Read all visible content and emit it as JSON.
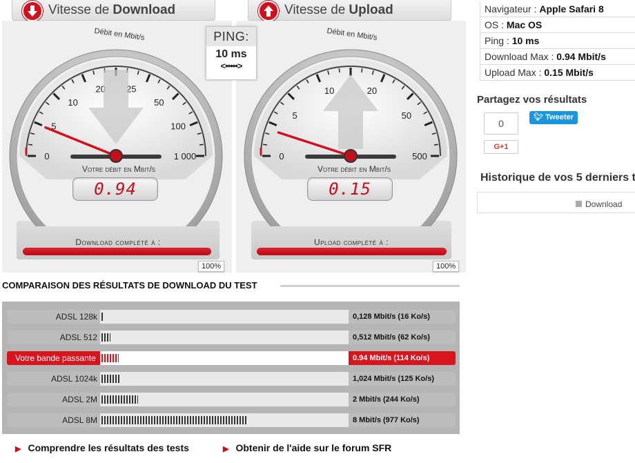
{
  "download": {
    "header_prefix": "Vitesse de",
    "header_bold": "Download",
    "unit_arc": "Débit en Mbit/s",
    "scale": [
      "0",
      "5",
      "10",
      "20",
      "25",
      "50",
      "100",
      "1 000"
    ],
    "caption": "Votre débit en Mbit/s",
    "value": "0.94",
    "complete_label": "Download complété à :",
    "progress": 1.0,
    "percent": "100%"
  },
  "upload": {
    "header_prefix": "Vitesse de",
    "header_bold": "Upload",
    "unit_arc": "Débit en Mbit/s",
    "scale": [
      "0",
      "5",
      "10",
      "20",
      "50",
      "500"
    ],
    "caption": "Votre débit en Mbit/s",
    "value": "0.15",
    "complete_label": "Upload complété à :",
    "progress": 1.0,
    "percent": "100%"
  },
  "ping": {
    "title": "PING:",
    "value": "10 ms",
    "dots": "<•••••>"
  },
  "info": [
    {
      "label": "Navigateur :",
      "value": "Apple Safari 8"
    },
    {
      "label": "OS :",
      "value": "Mac OS"
    },
    {
      "label": "Ping :",
      "value": "10 ms"
    },
    {
      "label": "Download Max :",
      "value": "0.94 Mbit/s"
    },
    {
      "label": "Upload Max :",
      "value": "0.15 Mbit/s"
    }
  ],
  "share": {
    "title": "Partagez vos résultats",
    "count": "0",
    "tweet_label": "Tweeter",
    "gplus_label": "G+1"
  },
  "history": {
    "title": "Historique de vos 5 derniers t",
    "legend": "Download"
  },
  "comparison": {
    "title": "COMPARAISON DES RÉSULTATS DE DOWNLOAD DU TEST",
    "rows": [
      {
        "name": "ADSL 128k",
        "value": "0,128 Mbit/s (16 Ko/s)",
        "mbps": 0.128,
        "highlight": false
      },
      {
        "name": "ADSL 512",
        "value": "0,512 Mbit/s (62 Ko/s)",
        "mbps": 0.512,
        "highlight": false
      },
      {
        "name": "Votre bande passante",
        "value": "0.94 Mbit/s (114 Ko/s)",
        "mbps": 0.94,
        "highlight": true
      },
      {
        "name": "ADSL 1024k",
        "value": "1,024 Mbit/s (125 Ko/s)",
        "mbps": 1.024,
        "highlight": false
      },
      {
        "name": "ADSL 2M",
        "value": "2 Mbit/s (244 Ko/s)",
        "mbps": 2,
        "highlight": false
      },
      {
        "name": "ADSL 8M",
        "value": "8 Mbit/s (977 Ko/s)",
        "mbps": 8,
        "highlight": false
      }
    ]
  },
  "links": [
    {
      "label": "Comprendre les résultats des tests"
    },
    {
      "label": "Obtenir de l'aide sur le forum SFR"
    }
  ],
  "colors": {
    "accent": "#d0101d",
    "twitter": "#1b95e0"
  }
}
